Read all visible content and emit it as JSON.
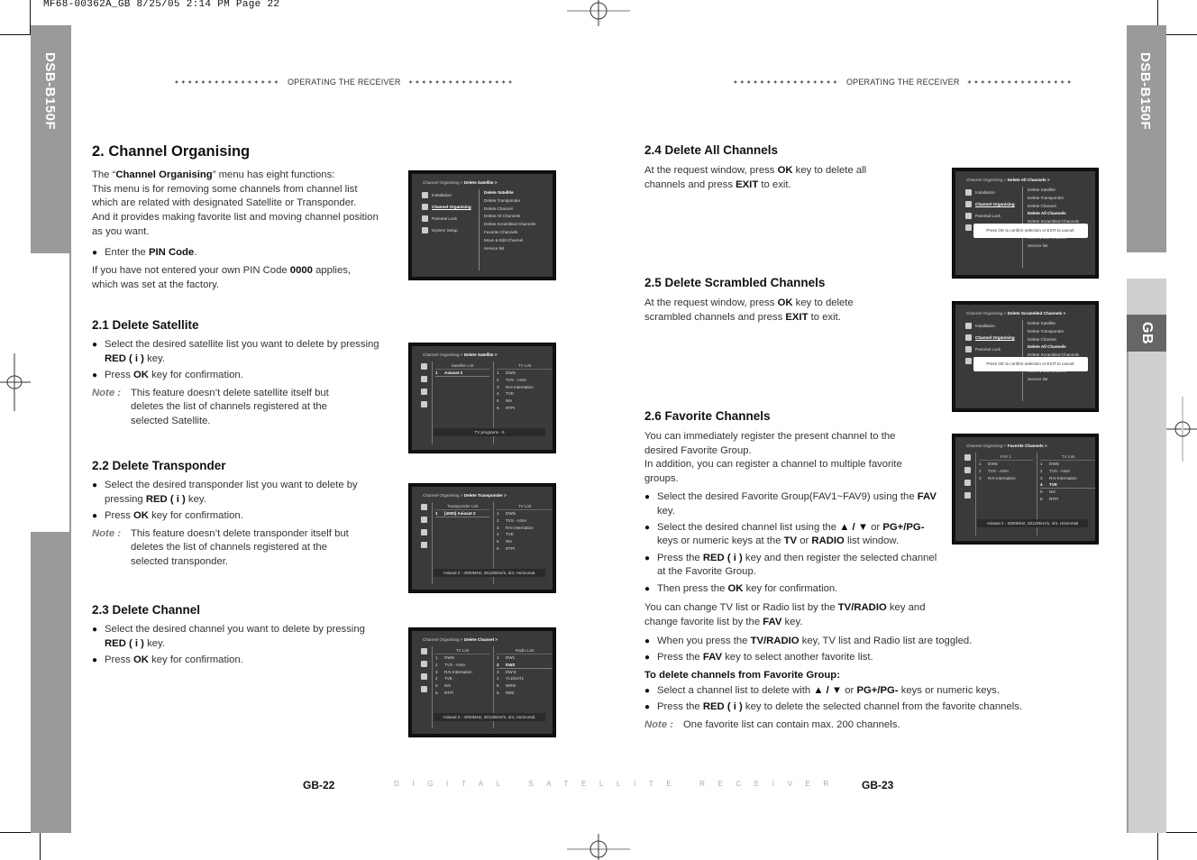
{
  "slug": "MF68-00362A_GB  8/25/05  2:14 PM  Page 22",
  "side_tabs": {
    "model": "DSB-B150F",
    "language": "GB"
  },
  "running_head": {
    "dots": "✦✦✦✦✦✦✦✦✦✦✦✦✦✦✦✦",
    "title": "OPERATING THE RECEIVER"
  },
  "left_page": {
    "main_title": "2. Channel Organising",
    "intro": {
      "p1_pre": "The “",
      "p1_bold": "Channel Organising",
      "p1_post": "” menu has eight functions:",
      "lines": [
        "This menu is for removing some channels from channel list",
        "which are related with designated Satellite or Transponder.",
        "And it provides making favorite list and moving channel position",
        "as you want."
      ],
      "bullet_pre": "Enter the ",
      "bullet_bold": "PIN Code",
      "bullet_post": ".",
      "pin_pre": "If you have not entered your own PIN Code ",
      "pin_bold": "0000",
      "pin_post": " applies, which was set at the factory."
    },
    "sections": [
      {
        "title": "2.1 Delete Satellite",
        "b1_pre": "Select the desired satellite list you want to delete by pressing ",
        "b1_bold": "RED ( i )",
        "b1_post": " key.",
        "b2_pre": "Press ",
        "b2_bold": "OK",
        "b2_post": " key for confirmation.",
        "note_label": "Note :",
        "note_text": "This feature doesn’t delete satellite itself but deletes the list of channels registered at the selected Satellite."
      },
      {
        "title": "2.2 Delete Transponder",
        "b1_pre": "Select the desired transponder list you want to delete by pressing ",
        "b1_bold": "RED ( i )",
        "b1_post": " key.",
        "b2_pre": "Press ",
        "b2_bold": "OK",
        "b2_post": " key for confirmation.",
        "note_label": "Note :",
        "note_text": "This feature doesn’t delete transponder itself but deletes the list of channels registered at the selected transponder."
      },
      {
        "title": "2.3 Delete Channel",
        "b1_pre": "Select the desired channel you want to delete by pressing ",
        "b1_bold": "RED ( i )",
        "b1_post": " key.",
        "b2_pre": "Press ",
        "b2_bold": "OK",
        "b2_post": " key for confirmation."
      }
    ],
    "page_number": "GB-22"
  },
  "right_page": {
    "sections": {
      "s24": {
        "title": "2.4 Delete All Channels",
        "pre": "At the request window, press ",
        "ok": "OK",
        "mid": " key to delete all channels and press ",
        "exit": "EXIT",
        "post": " to exit."
      },
      "s25": {
        "title": "2.5 Delete Scrambled Channels",
        "pre": "At the request window, press ",
        "ok": "OK",
        "mid": " key to delete scrambled channels and press ",
        "exit": "EXIT",
        "post": " to exit."
      },
      "s26": {
        "title": "2.6 Favorite Channels",
        "intro": "You can immediately register the present channel to the desired Favorite Group.",
        "intro2": "In addition, you can register a channel to multiple favorite groups.",
        "bullets": [
          {
            "pre": "Select the desired Favorite Group(FAV1~FAV9) using the ",
            "bold": "FAV",
            "post": " key."
          },
          {
            "pre": "Select the desired channel list using the ",
            "bold": "▲ / ▼",
            "mid": " or ",
            "bold2": "PG+/PG-",
            "post": " keys or numeric keys at the ",
            "bold3": "TV",
            "mid2": " or ",
            "bold4": "RADIO",
            "post2": " list window."
          },
          {
            "pre": "Press the ",
            "bold": "RED ( i )",
            "post": " key and then register the selected channel at the Favorite Group."
          },
          {
            "pre": "Then press the ",
            "bold": "OK",
            "post": " key for confirmation."
          }
        ],
        "change_pre": "You can change TV list or Radio list by the ",
        "change_bold": "TV/RADIO",
        "change_mid": " key and change favorite list by the ",
        "change_bold2": "FAV",
        "change_post": " key.",
        "bullets2": [
          {
            "pre": "When you press the ",
            "bold": "TV/RADIO",
            "post": " key, TV list and Radio list are toggled."
          },
          {
            "pre": "Press the ",
            "bold": "FAV",
            "post": " key to select another favorite list."
          }
        ],
        "delete_heading": "To delete channels from Favorite Group:",
        "bullets3": [
          {
            "pre": "Select a channel list to delete with ",
            "bold": "▲ / ▼",
            "mid": " or ",
            "bold2": "PG+/PG-",
            "post": " keys or numeric keys."
          },
          {
            "pre": "Press the ",
            "bold": "RED ( i )",
            "post": " key to delete the selected channel from the favorite channels."
          }
        ],
        "note_label": "Note :",
        "note_text": "One favorite list can contain max. 200 channels."
      }
    },
    "page_number": "GB-23"
  },
  "footer_center": "DIGITAL SATELLITE RECEIVER",
  "screens": {
    "menu_items_left": [
      "Installation",
      "Channel Organising",
      "Parental Lock",
      "System Setup"
    ],
    "menu_items_right": [
      "Delete Satellite",
      "Delete Transponder",
      "Delete Channel",
      "Delete All Channels",
      "Delete Scrambled Channels",
      "Favorite Channels",
      "Move & Edit Channel",
      "Service list"
    ],
    "crumb_prefix": "Channel Organising > ",
    "popup_text": "Press OK to confirm selection or EXIT to cancel.",
    "s_main": {
      "crumb": "Delete Satellite >"
    },
    "s_sat": {
      "crumb": "Delete Satellite >",
      "left_header": "Satellite List",
      "right_header": "TV List",
      "left_rows": [
        {
          "n": "1",
          "name": "Asiasat 2"
        }
      ],
      "right_rows": [
        {
          "n": "1",
          "name": "DWtv"
        },
        {
          "n": "2",
          "name": "TVS - ASIA"
        },
        {
          "n": "3",
          "name": "RAI Internation"
        },
        {
          "n": "4",
          "name": "TVE"
        },
        {
          "n": "5",
          "name": "NN"
        },
        {
          "n": "6",
          "name": "RTPi"
        }
      ],
      "footer": "TV programs - 6"
    },
    "s_tp": {
      "crumb": "Delete Transponder >",
      "left_header": "Transponder List",
      "right_header": "TV List",
      "left_rows": [
        {
          "n": "1",
          "name": "[4000] Asiasat 2"
        }
      ],
      "right_rows": [
        {
          "n": "1",
          "name": "DWtv"
        },
        {
          "n": "2",
          "name": "TVS - ASIA"
        },
        {
          "n": "3",
          "name": "RAI Internation"
        },
        {
          "n": "4",
          "name": "TVE"
        },
        {
          "n": "5",
          "name": "NN"
        },
        {
          "n": "6",
          "name": "RTPi"
        }
      ],
      "footer": "Asiasat 2 - 4000MHz, 28125kHz/s, 3/4, Horizontal."
    },
    "s_ch": {
      "crumb": "Delete Channel >",
      "left_header": "TV List",
      "right_header": "Radio List",
      "left_rows": [
        {
          "n": "1",
          "name": "DWtv"
        },
        {
          "n": "2",
          "name": "TVS - ASIA"
        },
        {
          "n": "3",
          "name": "RAI Internation"
        },
        {
          "n": "4",
          "name": "TVE"
        },
        {
          "n": "5",
          "name": "NN"
        },
        {
          "n": "6",
          "name": "RTPi"
        }
      ],
      "right_rows": [
        {
          "n": "1",
          "name": "DW1"
        },
        {
          "n": "2",
          "name": "DW2"
        },
        {
          "n": "3",
          "name": "DW 8"
        },
        {
          "n": "4",
          "name": "YLDSAT1"
        },
        {
          "n": "5",
          "name": "WRN"
        },
        {
          "n": "6",
          "name": "REE"
        }
      ],
      "footer": "Asiasat 2 - 4000MHz, 28125kHz/s, 3/4, Horizontal."
    },
    "s_all": {
      "crumb": "Delete All Channels >"
    },
    "s_scr": {
      "crumb": "Delete Scrambled Channels >"
    },
    "s_fav": {
      "crumb": "Favorite Channels >",
      "left_header": "FAV 1",
      "right_header": "TV List",
      "left_rows": [
        {
          "n": "1",
          "name": "DWtv"
        },
        {
          "n": "2",
          "name": "TVS - ASIA"
        },
        {
          "n": "3",
          "name": "RAI Internation"
        }
      ],
      "right_rows": [
        {
          "n": "1",
          "name": "DWtv"
        },
        {
          "n": "2",
          "name": "TVS - ASIA"
        },
        {
          "n": "3",
          "name": "RAI Internation"
        },
        {
          "n": "4",
          "name": "TVE"
        },
        {
          "n": "5",
          "name": "NN"
        },
        {
          "n": "6",
          "name": "RTPi"
        }
      ],
      "footer": "Asiasat 2 - 4000MHz, 28125kHz/s, 3/4, Horizontal"
    }
  }
}
